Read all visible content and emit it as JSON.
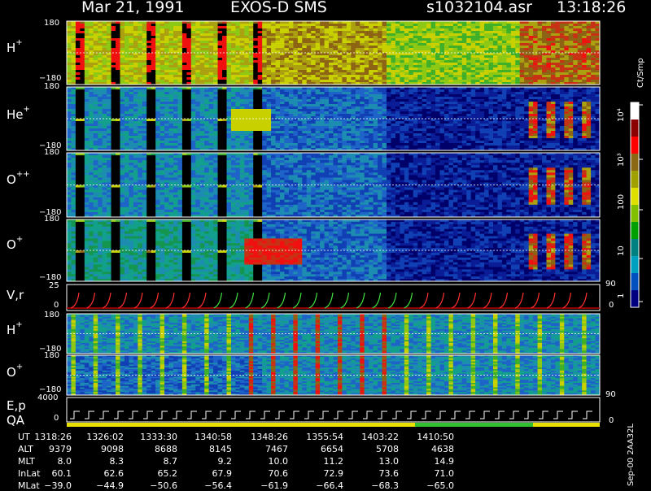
{
  "header": {
    "date": "Mar 21, 1991",
    "instrument": "EXOS-D SMS",
    "file": "s1032104.asr",
    "time": "13:18:26"
  },
  "panels": [
    {
      "id": "h-plus-top",
      "label": "H",
      "sup": "+",
      "top_tick": "180",
      "bottom_tick": "−180"
    },
    {
      "id": "he-plus",
      "label": "He",
      "sup": "+",
      "top_tick": "180",
      "bottom_tick": "−180"
    },
    {
      "id": "o-plusplus",
      "label": "O",
      "sup": "++",
      "top_tick": "180",
      "bottom_tick": "−180"
    },
    {
      "id": "o-plus-top",
      "label": "O",
      "sup": "+",
      "top_tick": "180",
      "bottom_tick": "−180"
    },
    {
      "id": "vr",
      "label": "V,r",
      "sup": "",
      "top_tick": "25",
      "bottom_tick": "0",
      "right_tick": "90"
    },
    {
      "id": "h-plus-bottom",
      "label": "H",
      "sup": "+",
      "top_tick": "180",
      "bottom_tick": "−180"
    },
    {
      "id": "o-plus-bottom",
      "label": "O",
      "sup": "+",
      "top_tick": "180",
      "bottom_tick": "−180",
      "right_tick": "90"
    },
    {
      "id": "ep-qa",
      "label": "E,p",
      "sup": "",
      "label2": "QA",
      "top_tick": "4000",
      "bottom_tick": "0",
      "right_tick": "0"
    }
  ],
  "colorbar": {
    "unit": "Ct/Smp",
    "labels": [
      "10⁴",
      "10³",
      "100",
      "10",
      "1",
      "0"
    ],
    "colors": [
      "#ffffff",
      "#8b0000",
      "#ff0000",
      "#8b6914",
      "#a0a000",
      "#e0e000",
      "#80c000",
      "#00a000",
      "#008080",
      "#00a0c0",
      "#0050c0",
      "#000080"
    ]
  },
  "footer_side_label": "Sep-00 2AA32L",
  "table": {
    "rows": [
      {
        "label": "UT",
        "values": [
          "1318:26",
          "1326:02",
          "1333:30",
          "1340:58",
          "1348:26",
          "1355:54",
          "1403:22",
          "1410:50"
        ]
      },
      {
        "label": "ALT",
        "values": [
          "9379",
          "9098",
          "8688",
          "8145",
          "7467",
          "6654",
          "5708",
          "4638"
        ]
      },
      {
        "label": "MLT",
        "values": [
          "8.0",
          "8.3",
          "8.7",
          "9.2",
          "10.0",
          "11.2",
          "13.0",
          "14.9"
        ]
      },
      {
        "label": "InLat",
        "values": [
          "60.1",
          "62.6",
          "65.2",
          "67.9",
          "70.6",
          "72.9",
          "73.6",
          "71.0"
        ]
      },
      {
        "label": "MLat",
        "values": [
          "−39.0",
          "−44.9",
          "−50.6",
          "−56.4",
          "−61.9",
          "−66.4",
          "−68.3",
          "−65.0"
        ]
      }
    ]
  },
  "chart_data": {
    "type": "heatmap",
    "title": "Mar 21, 1991   EXOS-D SMS",
    "x": [
      "1318:26",
      "1326:02",
      "1333:30",
      "1340:58",
      "1348:26",
      "1355:54",
      "1403:22",
      "1410:50"
    ],
    "xlabel": "UT",
    "ylim": [
      -180,
      180
    ],
    "series": [
      {
        "name": "H+",
        "ylim": [
          -180,
          180
        ]
      },
      {
        "name": "He+",
        "ylim": [
          -180,
          180
        ]
      },
      {
        "name": "O++",
        "ylim": [
          -180,
          180
        ]
      },
      {
        "name": "O+",
        "ylim": [
          -180,
          180
        ]
      },
      {
        "name": "V,r",
        "ylim": [
          0,
          25
        ]
      },
      {
        "name": "H+",
        "ylim": [
          -180,
          180
        ]
      },
      {
        "name": "O+",
        "ylim": [
          -180,
          180
        ]
      },
      {
        "name": "E,p",
        "ylim": [
          0,
          4000
        ]
      }
    ],
    "colorbar_scale": "log",
    "colorbar_range": [
      0,
      10000
    ]
  }
}
